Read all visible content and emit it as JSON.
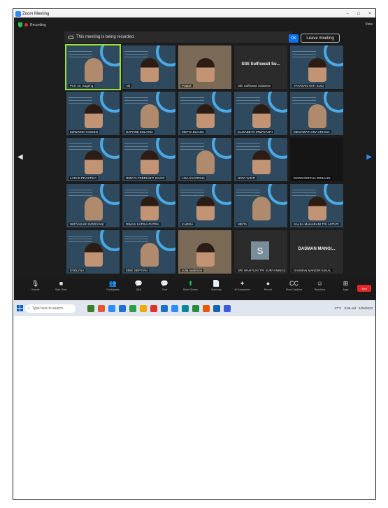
{
  "window": {
    "title": "Zoom Meeting",
    "controls": [
      "–",
      "□",
      "×"
    ]
  },
  "topbar": {
    "recording_label": "Recording",
    "banner_text": "This meeting is being recorded.",
    "ok_label": "OK",
    "leave_label": "Leave meeting",
    "view_label": "View"
  },
  "tiles": [
    {
      "name": "Prof. Dr. Sugeng",
      "kind": "slide",
      "active": true
    },
    {
      "name": "AB",
      "kind": "slide"
    },
    {
      "name": "Pratiwi",
      "kind": "photo"
    },
    {
      "name": "Stiti Sulfiswati Sulawesi",
      "kind": "name",
      "big_text": "Stiti Sulfiswati Su..."
    },
    {
      "name": "YAYASAN HATI SUCI",
      "kind": "slide"
    },
    {
      "name": "EDWARD HANSEN",
      "kind": "slide"
    },
    {
      "name": "DAPHNE ZULAIHA",
      "kind": "slide"
    },
    {
      "name": "MEFTA ELIANA",
      "kind": "slide"
    },
    {
      "name": "ELISABETH IRMAYANTI",
      "kind": "slide"
    },
    {
      "name": "MEGAWATI ANA ARIANA",
      "kind": "slide"
    },
    {
      "name": "LARAS PRASTIKA",
      "kind": "slide"
    },
    {
      "name": "RIZKYA FEBRIANTI SAVAT",
      "kind": "slide"
    },
    {
      "name": "LISA SYAFRINA",
      "kind": "slide"
    },
    {
      "name": "NOVI YANTI",
      "kind": "slide"
    },
    {
      "name": "MARGARETHA ROSALIN",
      "kind": "dark"
    },
    {
      "name": "WIDYASARI INDRIYANI",
      "kind": "slide"
    },
    {
      "name": "DIMAS SATRIA PUTRA",
      "kind": "slide"
    },
    {
      "name": "KARISA",
      "kind": "slide"
    },
    {
      "name": "MEITA",
      "kind": "slide"
    },
    {
      "name": "SALSA MAHARANI TRI ASTUTI",
      "kind": "slide"
    },
    {
      "name": "EVELYNA",
      "kind": "slide"
    },
    {
      "name": "ERIK SEPTIAN",
      "kind": "slide"
    },
    {
      "name": "Julia nadirman",
      "kind": "photo"
    },
    {
      "name": "SRI WAHYUNI TRI SURYANINGSIH",
      "kind": "avatar",
      "avatar_letter": "S"
    },
    {
      "name": "DASMAN MANGIRI ISKAL",
      "kind": "name",
      "big_text": "DASMAN MANGI..."
    }
  ],
  "nav": {
    "prev": "◀",
    "next": "▶"
  },
  "toolbar": {
    "items": [
      {
        "icon": "mic-icon",
        "glyph": "🎙",
        "label": "Unmute"
      },
      {
        "icon": "video-icon",
        "glyph": "■",
        "label": "Start Video"
      },
      {
        "icon": "spacer",
        "glyph": "",
        "label": ""
      },
      {
        "icon": "participants-icon",
        "glyph": "👥",
        "label": "Participants"
      },
      {
        "icon": "q-and-a-icon",
        "glyph": "💬",
        "label": "Q&A"
      },
      {
        "icon": "chat-icon",
        "glyph": "💬",
        "label": "Chat"
      },
      {
        "icon": "share-screen-icon",
        "glyph": "⬆",
        "label": "Share Screen"
      },
      {
        "icon": "summary-icon",
        "glyph": "📄",
        "label": "Summary"
      },
      {
        "icon": "ai-companion-icon",
        "glyph": "✦",
        "label": "AI Companion"
      },
      {
        "icon": "record-icon",
        "glyph": "●",
        "label": "Record"
      },
      {
        "icon": "show-captions-icon",
        "glyph": "CC",
        "label": "Show Captions"
      },
      {
        "icon": "reactions-icon",
        "glyph": "☺",
        "label": "Reactions"
      },
      {
        "icon": "apps-icon",
        "glyph": "⊞",
        "label": "Apps"
      }
    ],
    "end_label": "End"
  },
  "taskbar": {
    "search_placeholder": "Type here to search",
    "apps": [
      "#3b7d2a",
      "#e4572e",
      "#2d8cff",
      "#1e70d4",
      "#2f9e44",
      "#f2a900",
      "#e03131",
      "#1971c2",
      "#2d8cff",
      "#0c8599",
      "#2b8a3e",
      "#e8590c",
      "#1864ab",
      "#3b5bdb"
    ],
    "weather": "27°C",
    "time": "9:05 AM",
    "date": "5/29/2023"
  }
}
